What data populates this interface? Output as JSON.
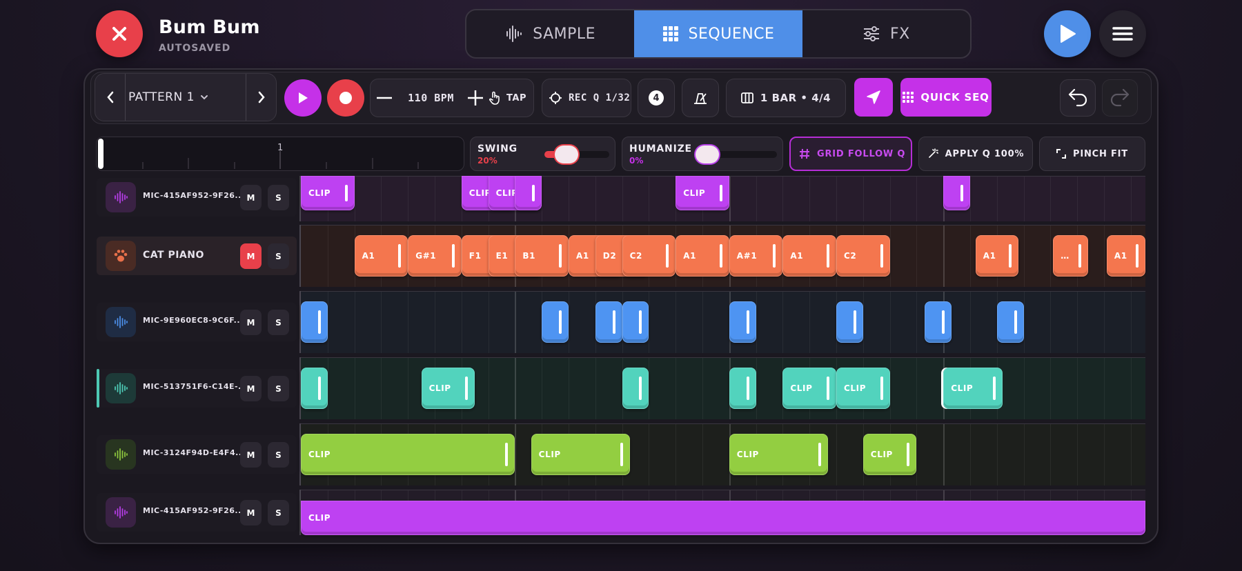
{
  "header": {
    "title": "Bum Bum",
    "subtitle": "AUTOSAVED",
    "tabs": [
      {
        "label": "SAMPLE",
        "icon": "waveform-icon"
      },
      {
        "label": "SEQUENCE",
        "icon": "grid-icon",
        "active": true
      },
      {
        "label": "FX",
        "icon": "sliders-icon"
      }
    ]
  },
  "toolbar": {
    "pattern": "PATTERN 1",
    "bpm": "110 BPM",
    "tap": "TAP",
    "rec_q": "REC Q 1/32",
    "count_in": "4",
    "bar": "1 BAR • 4/4",
    "quick_seq": "QUICK SEQ"
  },
  "controls": {
    "ruler_marker": "1",
    "swing": {
      "label": "SWING",
      "value": "20%"
    },
    "humanize": {
      "label": "HUMANIZE",
      "value": "0%"
    },
    "grid_follow": "GRID FOLLOW Q",
    "apply_q": "APPLY Q 100%",
    "pinch_fit": "PINCH FIT"
  },
  "colors": {
    "accent_blue": "#4f8fe8",
    "accent_pink": "#c531e8",
    "record_red": "#e8404a",
    "purple_track": "#b53ee6",
    "orange_track": "#e8704a",
    "blue_track": "#4a8de6",
    "teal_track": "#4ec9b4",
    "green_track": "#8cc43e"
  },
  "tracks": [
    {
      "name": "MIC-415AF952-9F26...",
      "mute": "M",
      "solo": "S"
    },
    {
      "name": "CAT PIANO",
      "mute": "M",
      "solo": "S"
    },
    {
      "name": "MIC-9E960EC8-9C6F...",
      "mute": "M",
      "solo": "S"
    },
    {
      "name": "MIC-513751F6-C14E-...",
      "mute": "M",
      "solo": "S"
    },
    {
      "name": "MIC-3124F94D-E4F4...",
      "mute": "M",
      "solo": "S"
    },
    {
      "name": "MIC-415AF952-9F26...",
      "mute": "M",
      "solo": "S"
    }
  ],
  "clip_labels": {
    "clip": "CLIP",
    "clip_short": "CLIP",
    "notes": [
      "A1",
      "G#1",
      "F1",
      "E1",
      "B1",
      "A1",
      "D2",
      "C2",
      "A1",
      "A#1",
      "A1",
      "C2",
      "A1",
      "…",
      "A1"
    ]
  }
}
